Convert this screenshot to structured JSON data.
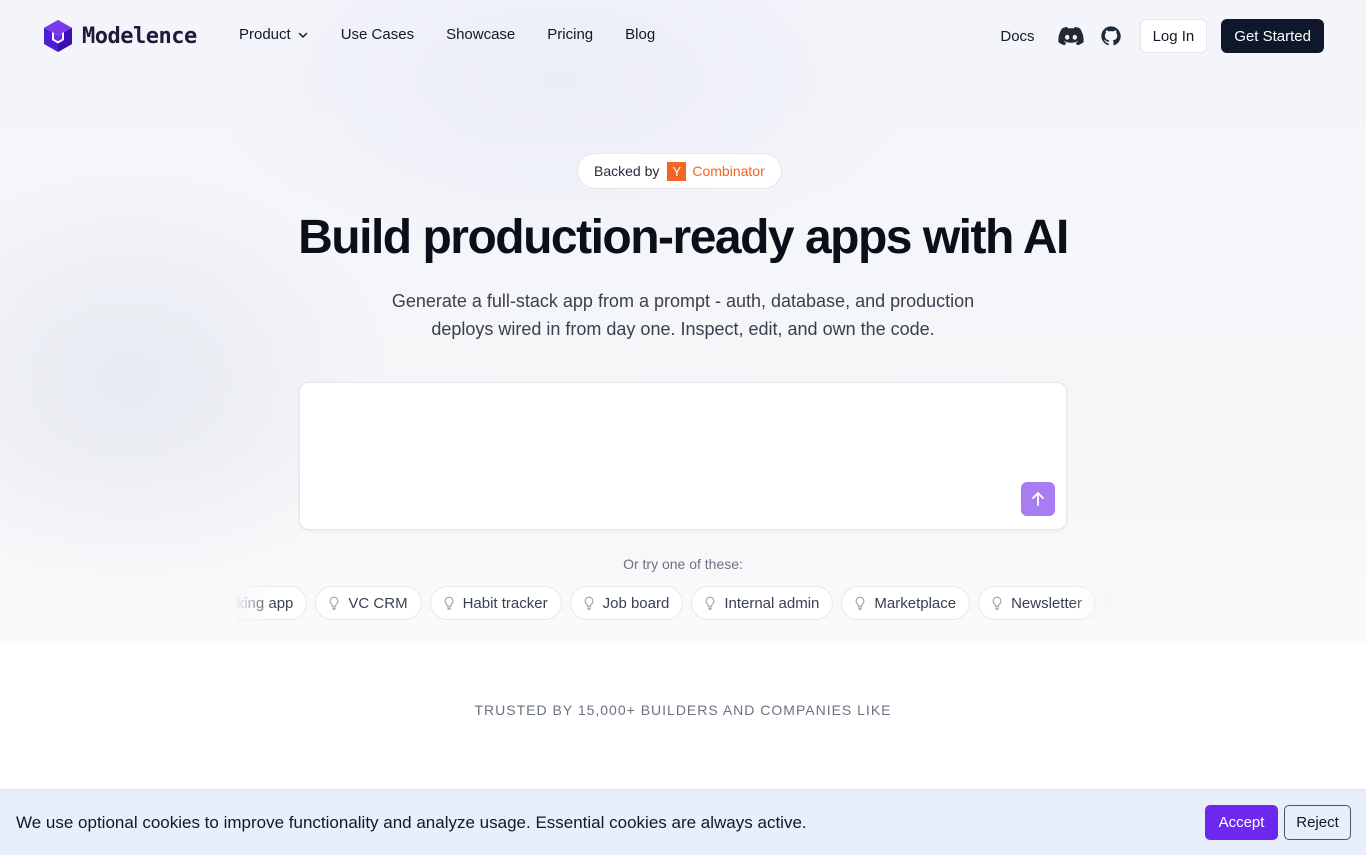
{
  "brand": {
    "name": "Modelence",
    "logo_icon": "hexagon-cube-logo",
    "accent": "#5b21e6"
  },
  "nav": {
    "items": [
      {
        "label": "Product",
        "has_dropdown": true
      },
      {
        "label": "Use Cases"
      },
      {
        "label": "Showcase"
      },
      {
        "label": "Pricing"
      },
      {
        "label": "Blog"
      }
    ],
    "docs_label": "Docs",
    "icons": [
      "discord-icon",
      "github-icon"
    ],
    "login_label": "Log In",
    "cta_label": "Get Started"
  },
  "hero": {
    "badge_prefix": "Backed by",
    "badge_logo_letter": "Y",
    "badge_name": "Combinator",
    "badge_color": "#f26522",
    "title": "Build production-ready apps with AI",
    "subtitle_line1": "Generate a full-stack app from a prompt - auth, database, and production",
    "subtitle_line2": "deploys wired in from day one. Inspect, edit, and own the code.",
    "prompt_value": "",
    "send_icon": "arrow-up-icon",
    "send_color": "#a77df1",
    "try_label": "Or try one of these:",
    "suggestions": [
      "Booking app",
      "VC CRM",
      "Habit tracker",
      "Job board",
      "Internal admin",
      "Marketplace",
      "Newsletter"
    ]
  },
  "trusted": {
    "label": "TRUSTED BY 15,000+ BUILDERS AND COMPANIES LIKE"
  },
  "cookie": {
    "message": "We use optional cookies to improve functionality and analyze usage. Essential cookies are always active.",
    "accept_label": "Accept",
    "reject_label": "Reject",
    "accept_color": "#6d28f0"
  }
}
